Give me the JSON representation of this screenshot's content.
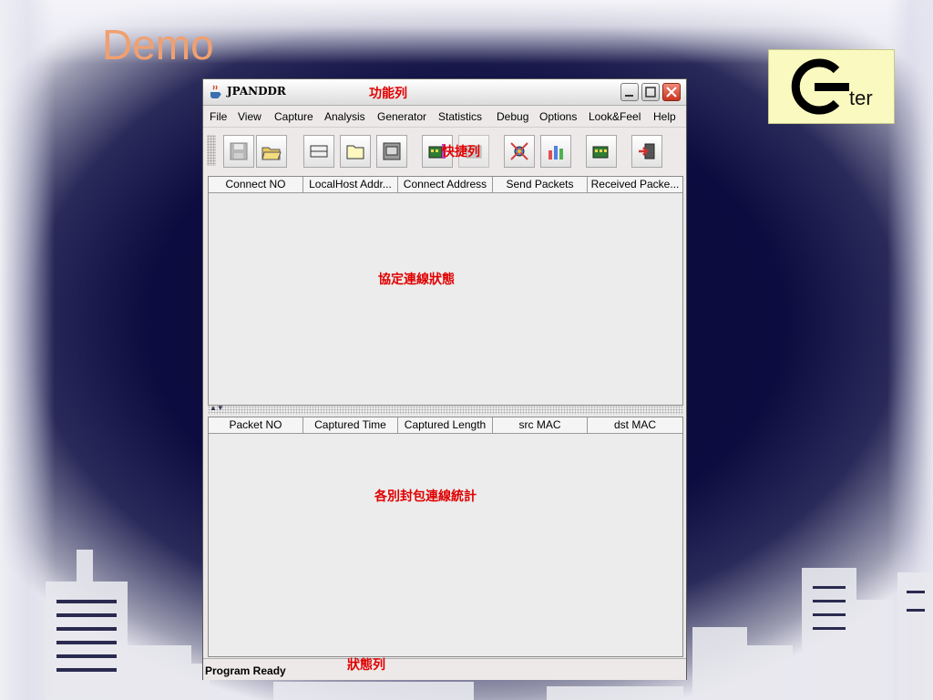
{
  "slide": {
    "title": "Demo",
    "logo_text": "ter"
  },
  "window": {
    "title": "JPANDDR",
    "minimize_label": "",
    "maximize_label": "",
    "close_label": ""
  },
  "annotations": {
    "menubar": "功能列",
    "toolbar": "快捷列",
    "connections": "協定連線狀態",
    "packets": "各別封包連線統計",
    "statusbar": "狀態列"
  },
  "menu": [
    "File",
    "View",
    "Capture",
    "Analysis",
    "Generator",
    "Statistics",
    "Debug",
    "Options",
    "Look&Feel",
    "Help"
  ],
  "toolbar_icons": [
    "save-icon",
    "open-folder-icon",
    "window-icon",
    "folder-icon",
    "window-frame-icon",
    "network-card-icon",
    "gear-card-icon",
    "satellite-icon",
    "bar-chart-icon",
    "card-icon",
    "exit-icon"
  ],
  "connection_table": {
    "columns": [
      "Connect NO",
      "LocalHost Addr...",
      "Connect Address",
      "Send Packets",
      "Received Packe..."
    ]
  },
  "packet_table": {
    "columns": [
      "Packet NO",
      "Captured Time",
      "Captured Length",
      "src MAC",
      "dst MAC"
    ]
  },
  "status": {
    "text": "Program Ready"
  },
  "colors": {
    "title": "#f0a070",
    "annotation": "#e00000",
    "background": "#0b0b3a"
  }
}
